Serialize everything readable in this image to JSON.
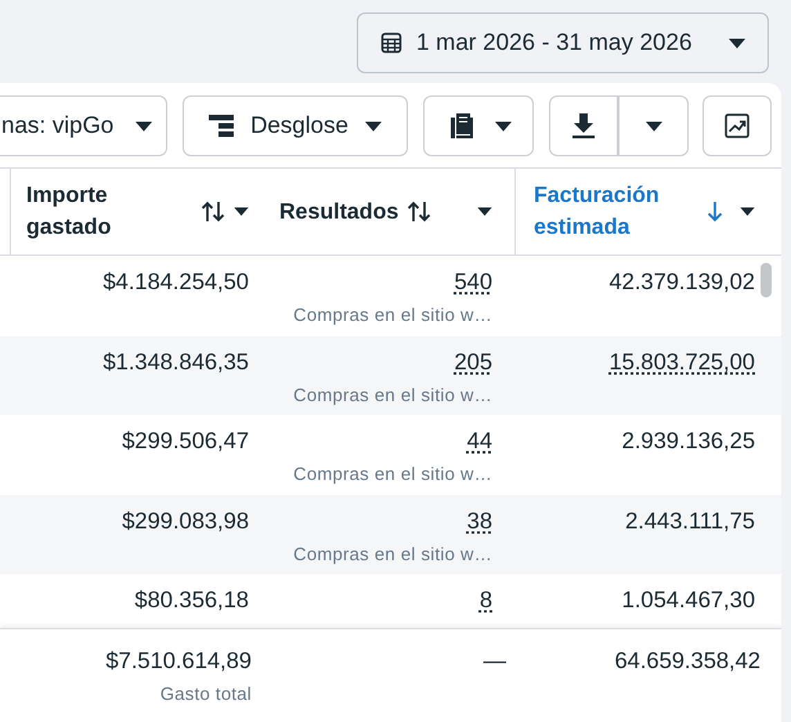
{
  "date_range": {
    "label": "1 mar 2026 - 31 may 2026"
  },
  "toolbar": {
    "filter_button": "nas: vipGo",
    "breakdown_button": "Desglose"
  },
  "columns": [
    {
      "label": "Importe gastado",
      "active": false
    },
    {
      "label": "Resultados",
      "active": false
    },
    {
      "label": "Facturación estimada",
      "active": true
    }
  ],
  "rows": [
    {
      "spent": "$4.184.254,50",
      "results": "540",
      "result_type": "Compras en el sitio w…",
      "revenue": "42.379.139,02",
      "revenue_underlined": false
    },
    {
      "spent": "$1.348.846,35",
      "results": "205",
      "result_type": "Compras en el sitio w…",
      "revenue": "15.803.725,00",
      "revenue_underlined": true
    },
    {
      "spent": "$299.506,47",
      "results": "44",
      "result_type": "Compras en el sitio w…",
      "revenue": "2.939.136,25",
      "revenue_underlined": false
    },
    {
      "spent": "$299.083,98",
      "results": "38",
      "result_type": "Compras en el sitio w…",
      "revenue": "2.443.111,75",
      "revenue_underlined": false
    },
    {
      "spent": "$80.356,18",
      "results": "8",
      "revenue": "1.054.467,30",
      "revenue_underlined": false
    }
  ],
  "totals": {
    "spent": "$7.510.614,89",
    "spent_label": "Gasto total",
    "results": "—",
    "revenue": "64.659.358,42"
  }
}
